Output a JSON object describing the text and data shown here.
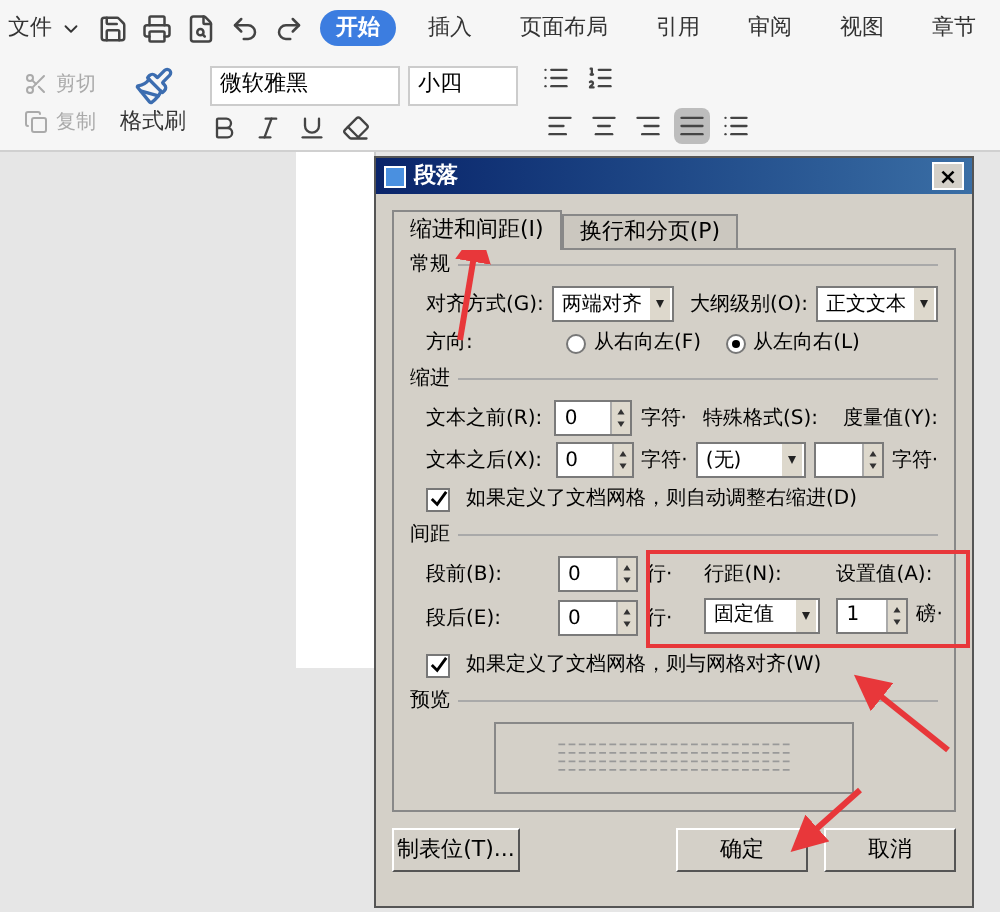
{
  "menu_bar": {
    "file_menu": "文件",
    "tabs": [
      {
        "label": "开始",
        "selected": true
      },
      {
        "label": "插入",
        "selected": false
      },
      {
        "label": "页面布局",
        "selected": false
      },
      {
        "label": "引用",
        "selected": false
      },
      {
        "label": "审阅",
        "selected": false
      },
      {
        "label": "视图",
        "selected": false
      },
      {
        "label": "章节",
        "selected": false
      }
    ]
  },
  "ribbon": {
    "clipboard": [
      {
        "label": "剪切",
        "disabled": true
      },
      {
        "label": "复制",
        "disabled": true
      }
    ],
    "format_painter": "格式刷",
    "font": "微软雅黑",
    "size": "小四",
    "paragraph_align": [
      {
        "selected": false
      },
      {
        "selected": false
      },
      {
        "selected": false
      },
      {
        "selected": true
      },
      {
        "selected": false
      }
    ]
  },
  "dialog": {
    "title": "段落",
    "close": "×",
    "tabs": [
      {
        "label": "缩进和间距(I)",
        "selected": true
      },
      {
        "label": "换行和分页(P)",
        "selected": false
      }
    ],
    "general": {
      "heading": "常规",
      "align_label": "对齐方式(G):",
      "align_value": "两端对齐",
      "outline_label": "大纲级别(O):",
      "outline_value": "正文文本",
      "direction_label": "方向:",
      "directions": [
        {
          "label": "从右向左(F)",
          "selected": false
        },
        {
          "label": "从左向右(L)",
          "selected": true
        }
      ]
    },
    "indent": {
      "heading": "缩进",
      "before_label": "文本之前(R):",
      "before_value": "0",
      "before_unit": "字符·",
      "special_label": "特殊格式(S):",
      "measure_label": "度量值(Y):",
      "after_label": "文本之后(X):",
      "after_value": "0",
      "after_unit": "字符·",
      "special_value": "(无)",
      "measure_unit": "字符·",
      "auto_adjust": {
        "label": "如果定义了文档网格，则自动调整右缩进(D)",
        "checked": true
      }
    },
    "spacing": {
      "heading": "间距",
      "before_label": "段前(B):",
      "before_value": "0",
      "before_unit": "行·",
      "after_label": "段后(E):",
      "after_value": "0",
      "after_unit": "行·",
      "line_label": "行距(N):",
      "line_value": "固定值",
      "set_label": "设置值(A):",
      "set_value": "1",
      "set_unit": "磅·",
      "snap_grid": {
        "label": "如果定义了文档网格，则与网格对齐(W)",
        "checked": true
      }
    },
    "preview": {
      "heading": "预览"
    },
    "buttons": [
      {
        "label": "制表位(T)..."
      },
      {
        "label": "确定"
      },
      {
        "label": "取消"
      }
    ]
  }
}
